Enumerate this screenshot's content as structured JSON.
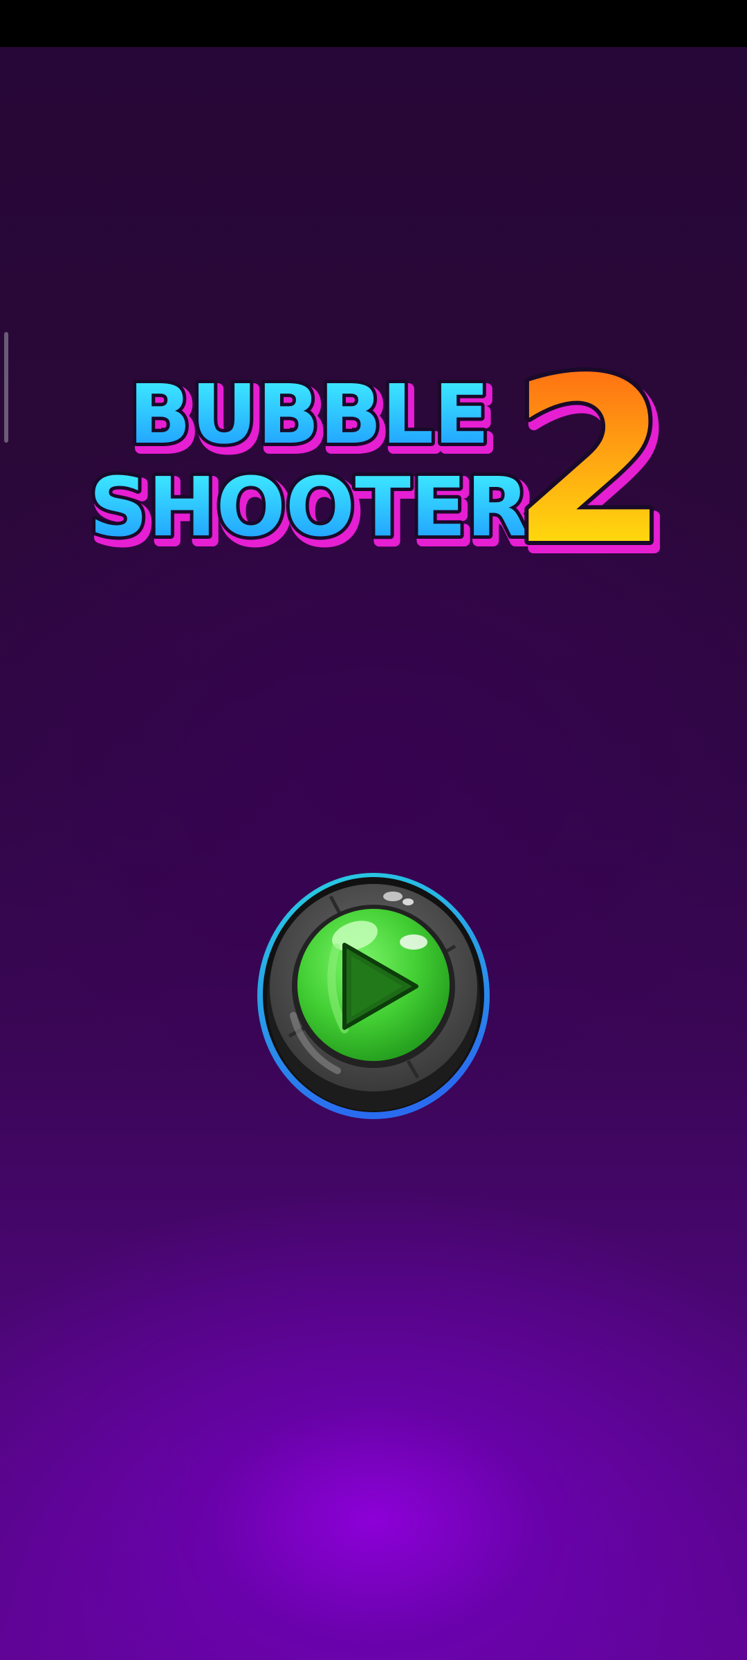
{
  "game": {
    "title_line1": "BUBBLE",
    "title_line2": "SHOOTER",
    "title_number": "2",
    "play_button_icon": "play-icon"
  },
  "colors": {
    "title_cyan_top": "#3ff2ff",
    "title_cyan_bottom": "#1e9bff",
    "title_outline_magenta": "#e61fd3",
    "number_orange": "#ff6a12",
    "number_yellow": "#fffb0a",
    "play_green": "#4bd83a",
    "play_ring_cyan": "#27d3e0",
    "play_ring_blue": "#2a6cf0",
    "bg_top": "#270737",
    "bg_bottom_glow": "#8a00d6"
  }
}
